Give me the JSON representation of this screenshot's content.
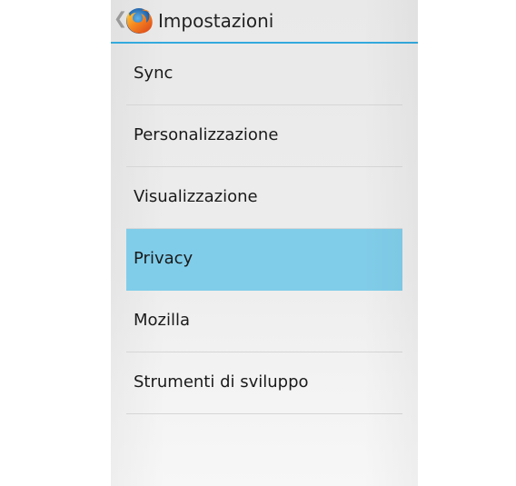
{
  "actionbar": {
    "back_icon": "back-chevron-icon",
    "logo_icon": "firefox-logo-icon",
    "title": "Impostazioni"
  },
  "settings": {
    "items": [
      {
        "label": "Sync"
      },
      {
        "label": "Personalizzazione"
      },
      {
        "label": "Visualizzazione"
      },
      {
        "label": "Privacy",
        "selected": true
      },
      {
        "label": "Mozilla"
      },
      {
        "label": "Strumenti di sviluppo"
      }
    ]
  },
  "colors": {
    "accent_underline": "#33a9dd",
    "selected_background": "#80cde9",
    "text": "#1a1a1a"
  }
}
